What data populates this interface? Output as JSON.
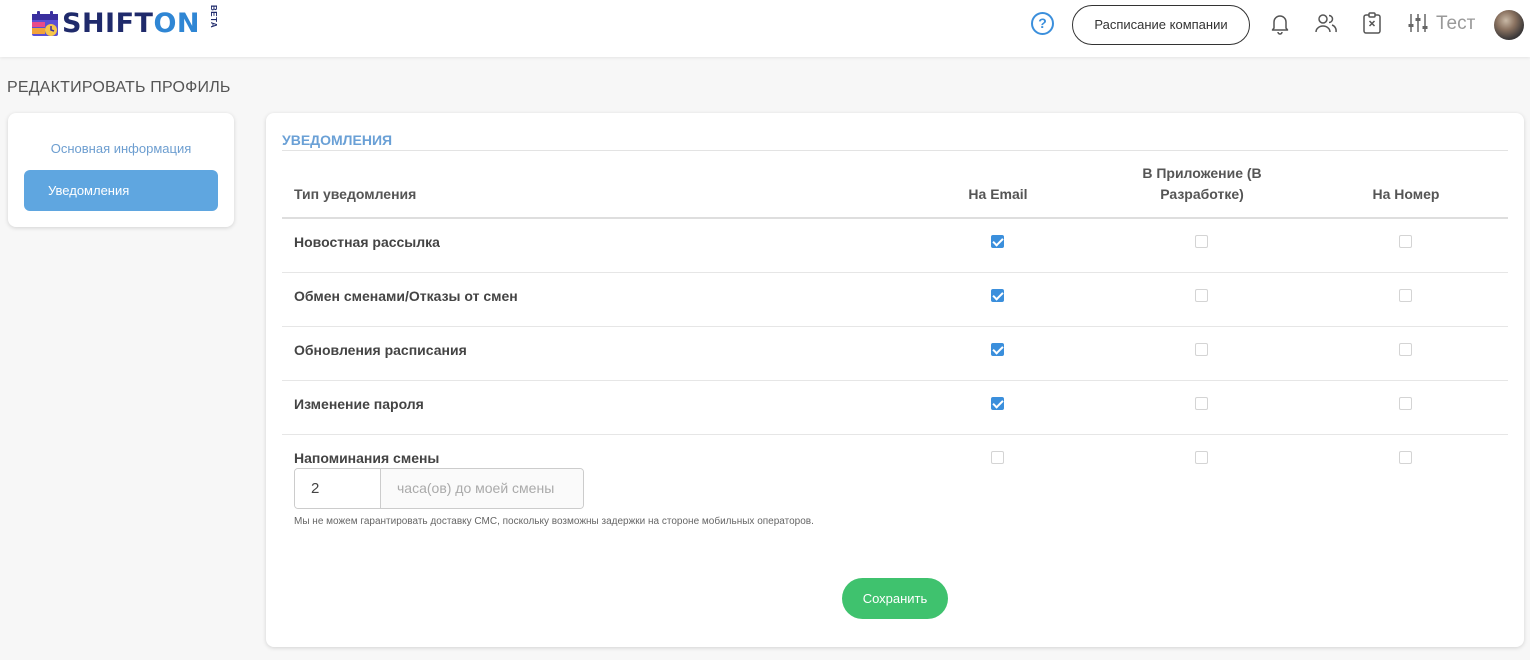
{
  "header": {
    "logo_shift": "SHIFT",
    "logo_on": "ON",
    "logo_beta": "BETA",
    "schedule_button": "Расписание компании",
    "user_name": "Тест",
    "icons": [
      "help-icon",
      "bell-icon",
      "users-icon",
      "clipboard-icon",
      "sliders-icon"
    ]
  },
  "page": {
    "title": "РЕДАКТИРОВАТЬ ПРОФИЛЬ"
  },
  "sidebar": {
    "items": [
      {
        "label": "Основная информация",
        "active": false
      },
      {
        "label": "Уведомления",
        "active": true
      }
    ]
  },
  "notifications": {
    "section_title": "УВЕДОМЛЕНИЯ",
    "columns": {
      "type": "Тип уведомления",
      "email": "На Email",
      "app_line1": "В Приложение (В",
      "app_line2": "Разработке)",
      "phone": "На Номер"
    },
    "rows": [
      {
        "label": "Новостная рассылка",
        "email": true,
        "app": false,
        "phone": false
      },
      {
        "label": "Обмен сменами/Отказы от смен",
        "email": true,
        "app": false,
        "phone": false
      },
      {
        "label": "Обновления расписания",
        "email": true,
        "app": false,
        "phone": false
      },
      {
        "label": "Изменение пароля",
        "email": true,
        "app": false,
        "phone": false
      },
      {
        "label": "Напоминания смены",
        "email": false,
        "app": false,
        "phone": false
      }
    ],
    "reminder": {
      "hours_value": "2",
      "hours_suffix": "часа(ов) до моей смены"
    },
    "sms_note": "Мы не можем гарантировать доставку СМС, поскольку возможны задержки на стороне мобильных операторов.",
    "save_button": "Сохранить"
  },
  "colors": {
    "accent": "#3b8fdc",
    "sidebar_active": "#5fa6e0",
    "save": "#3fc26e",
    "logo_dark": "#1f2a6b"
  }
}
